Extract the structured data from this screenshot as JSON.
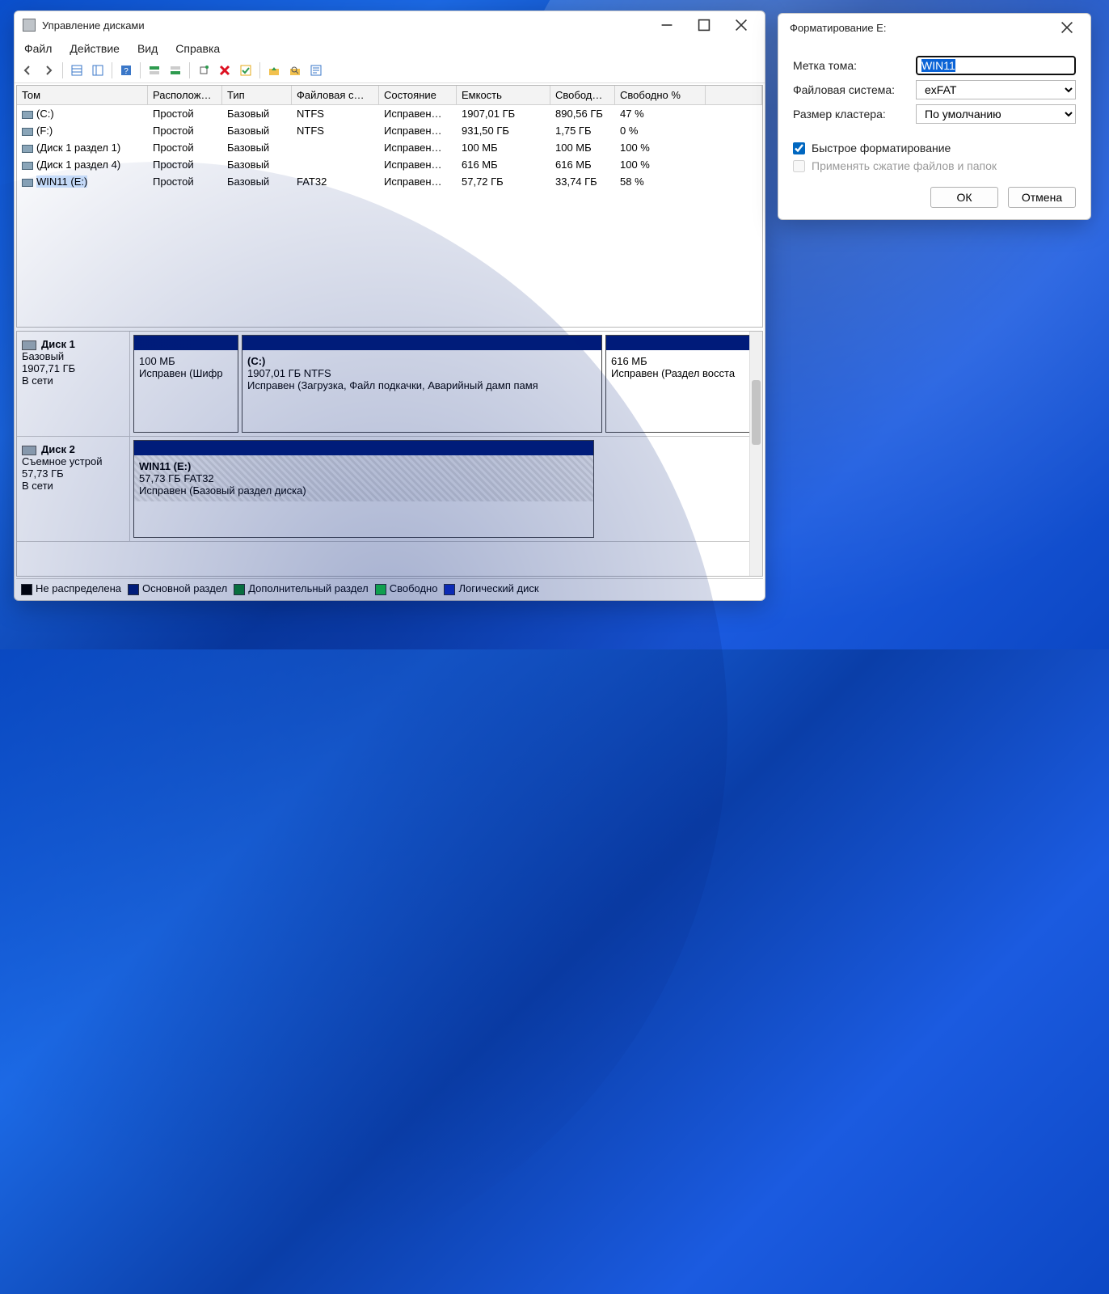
{
  "dm": {
    "title": "Управление дисками",
    "menu": {
      "file": "Файл",
      "action": "Действие",
      "view": "Вид",
      "help": "Справка"
    },
    "columns": {
      "vol": "Том",
      "layout": "Располож…",
      "type": "Тип",
      "fs": "Файловая с…",
      "status": "Состояние",
      "capacity": "Емкость",
      "free": "Свобод…",
      "freepct": "Свободно %"
    },
    "rows": [
      {
        "vol": "(C:)",
        "layout": "Простой",
        "type": "Базовый",
        "fs": "NTFS",
        "status": "Исправен…",
        "cap": "1907,01 ГБ",
        "free": "890,56 ГБ",
        "pct": "47 %"
      },
      {
        "vol": "(F:)",
        "layout": "Простой",
        "type": "Базовый",
        "fs": "NTFS",
        "status": "Исправен…",
        "cap": "931,50 ГБ",
        "free": "1,75 ГБ",
        "pct": "0 %"
      },
      {
        "vol": "(Диск 1 раздел 1)",
        "layout": "Простой",
        "type": "Базовый",
        "fs": "",
        "status": "Исправен…",
        "cap": "100 МБ",
        "free": "100 МБ",
        "pct": "100 %"
      },
      {
        "vol": "(Диск 1 раздел 4)",
        "layout": "Простой",
        "type": "Базовый",
        "fs": "",
        "status": "Исправен…",
        "cap": "616 МБ",
        "free": "616 МБ",
        "pct": "100 %"
      },
      {
        "vol": "WIN11 (E:)",
        "layout": "Простой",
        "type": "Базовый",
        "fs": "FAT32",
        "status": "Исправен…",
        "cap": "57,72 ГБ",
        "free": "33,74 ГБ",
        "pct": "58 %",
        "selected": true
      }
    ],
    "disk1": {
      "name": "Диск 1",
      "type": "Базовый",
      "size": "1907,71 ГБ",
      "status": "В сети",
      "p1": {
        "size": "100 МБ",
        "status": "Исправен (Шифр"
      },
      "p2": {
        "name": "(C:)",
        "size": "1907,01 ГБ NTFS",
        "status": "Исправен (Загрузка, Файл подкачки, Аварийный дамп памя"
      },
      "p3": {
        "size": "616 МБ",
        "status": "Исправен (Раздел восста"
      }
    },
    "disk2": {
      "name": "Диск 2",
      "type": "Съемное устрой",
      "size": "57,73 ГБ",
      "status": "В сети",
      "p1": {
        "name": "WIN11  (E:)",
        "size": "57,73 ГБ FAT32",
        "status": "Исправен (Базовый раздел диска)"
      }
    },
    "legend": {
      "unalloc": "Не распределена",
      "primary": "Основной раздел",
      "extended": "Дополнительный раздел",
      "free": "Свободно",
      "logical": "Логический диск"
    }
  },
  "fmt": {
    "title": "Форматирование E:",
    "label_vol": "Метка тома:",
    "label_fs": "Файловая система:",
    "label_cluster": "Размер кластера:",
    "val_vol": "WIN11",
    "val_fs": "exFAT",
    "val_cluster": "По умолчанию",
    "chk_quick": "Быстрое форматирование",
    "chk_compress": "Применять сжатие файлов и папок",
    "ok": "ОК",
    "cancel": "Отмена"
  }
}
